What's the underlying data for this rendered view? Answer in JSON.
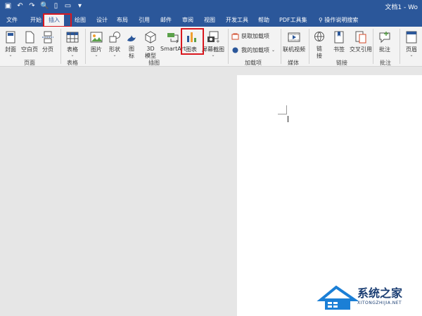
{
  "window": {
    "title_fragment": "文档1 - Wo"
  },
  "qat": [
    {
      "name": "save-icon",
      "glyph": "▣"
    },
    {
      "name": "undo-icon",
      "glyph": "↶"
    },
    {
      "name": "redo-icon",
      "glyph": "↷"
    },
    {
      "name": "print-preview-icon",
      "glyph": "🔍"
    },
    {
      "name": "new-doc-icon",
      "glyph": "▯"
    },
    {
      "name": "open-folder-icon",
      "glyph": "▭"
    },
    {
      "name": "customize-qat-icon",
      "glyph": "▾"
    }
  ],
  "tabs": [
    {
      "id": "file",
      "label": "文件"
    },
    {
      "id": "home",
      "label": "开始"
    },
    {
      "id": "insert",
      "label": "插入",
      "active": true
    },
    {
      "id": "draw",
      "label": "绘图"
    },
    {
      "id": "design",
      "label": "设计"
    },
    {
      "id": "layout",
      "label": "布局"
    },
    {
      "id": "references",
      "label": "引用"
    },
    {
      "id": "mailings",
      "label": "邮件"
    },
    {
      "id": "review",
      "label": "审阅"
    },
    {
      "id": "view",
      "label": "视图"
    },
    {
      "id": "developer",
      "label": "开发工具"
    },
    {
      "id": "help",
      "label": "帮助"
    },
    {
      "id": "pdf",
      "label": "PDF工具集"
    },
    {
      "id": "tellme",
      "label": "操作说明搜索"
    }
  ],
  "ribbon": {
    "pages": {
      "group": "页面",
      "cover": "封面",
      "blank": "空白页",
      "break": "分页"
    },
    "tables": {
      "group": "表格",
      "table": "表格"
    },
    "illustrations": {
      "group": "插图",
      "pictures": "图片",
      "shapes": "形状",
      "icons": "图标",
      "models": "3D 模型",
      "smartart": "SmartArt",
      "chart": "图表",
      "screenshot": "屏幕截图"
    },
    "addins": {
      "group": "加载项",
      "get": "获取加载项",
      "my": "我的加载项"
    },
    "media": {
      "group": "媒体",
      "video": "联机视频"
    },
    "links": {
      "group": "链接",
      "link": "链接",
      "bookmark": "书签",
      "crossref": "交叉引用"
    },
    "comments": {
      "group": "批注",
      "comment": "批注"
    },
    "header": {
      "label": "页眉"
    }
  },
  "watermark": {
    "cn": "系统之家",
    "en": "XITONGZHIJIA.NET"
  },
  "colors": {
    "titlebar": "#2b579a",
    "highlight": "#d9181f",
    "ribbon": "#f3f3f3",
    "canvas": "#e6e6e6"
  }
}
